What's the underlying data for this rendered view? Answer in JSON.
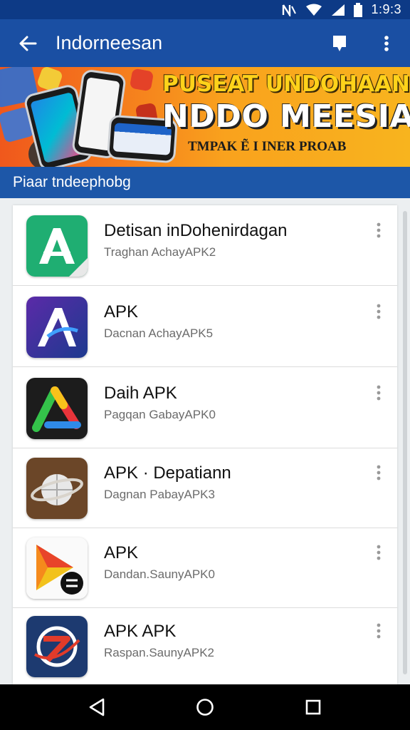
{
  "status_bar": {
    "time": "1:9:3",
    "icons": [
      "nfc-icon",
      "wifi-icon",
      "signal-icon",
      "battery-icon"
    ]
  },
  "app_bar": {
    "title": "Indorneesan",
    "back_icon": "arrow-back-icon",
    "actions": [
      "bookmark-icon",
      "more-vert-icon"
    ]
  },
  "banner": {
    "headline_1": "PUSEAT UNDOHAAN",
    "headline_2": "NDDO MEESIA",
    "tagline": "TMPAK Ẽ I INER PROAB"
  },
  "section": {
    "title": "Piaar tndeephobg"
  },
  "apps": [
    {
      "name": "Detisan inDohenirdagan",
      "subtitle": "Traghan AchayAPK2",
      "icon": "green-a-logo-icon"
    },
    {
      "name": "APK",
      "subtitle": "Dacnan AchayAPK5",
      "icon": "purple-a-logo-icon"
    },
    {
      "name": "Daih APK",
      "subtitle": "Pagqan GabayAPK0",
      "icon": "multicolor-triangle-logo-icon"
    },
    {
      "name": "APK · Depatiann",
      "subtitle": "Dagnan PabayAPK3",
      "icon": "planet-ring-logo-icon"
    },
    {
      "name": "APK",
      "subtitle": "Dandan.SaunyAPK0",
      "icon": "play-arrow-logo-icon"
    },
    {
      "name": "APK APK",
      "subtitle": "Raspan.SaunyAPK2",
      "icon": "red-swoosh-logo-icon"
    }
  ],
  "nav_bar": {
    "buttons": [
      "back-triangle-icon",
      "home-circle-icon",
      "recents-square-icon"
    ]
  },
  "colors": {
    "status_bar": "#0d3a86",
    "app_bar": "#1a4fa3",
    "section_bar": "#1d57a8",
    "banner_orange": "#f57d1d",
    "banner_yellow": "#ffd21a"
  }
}
